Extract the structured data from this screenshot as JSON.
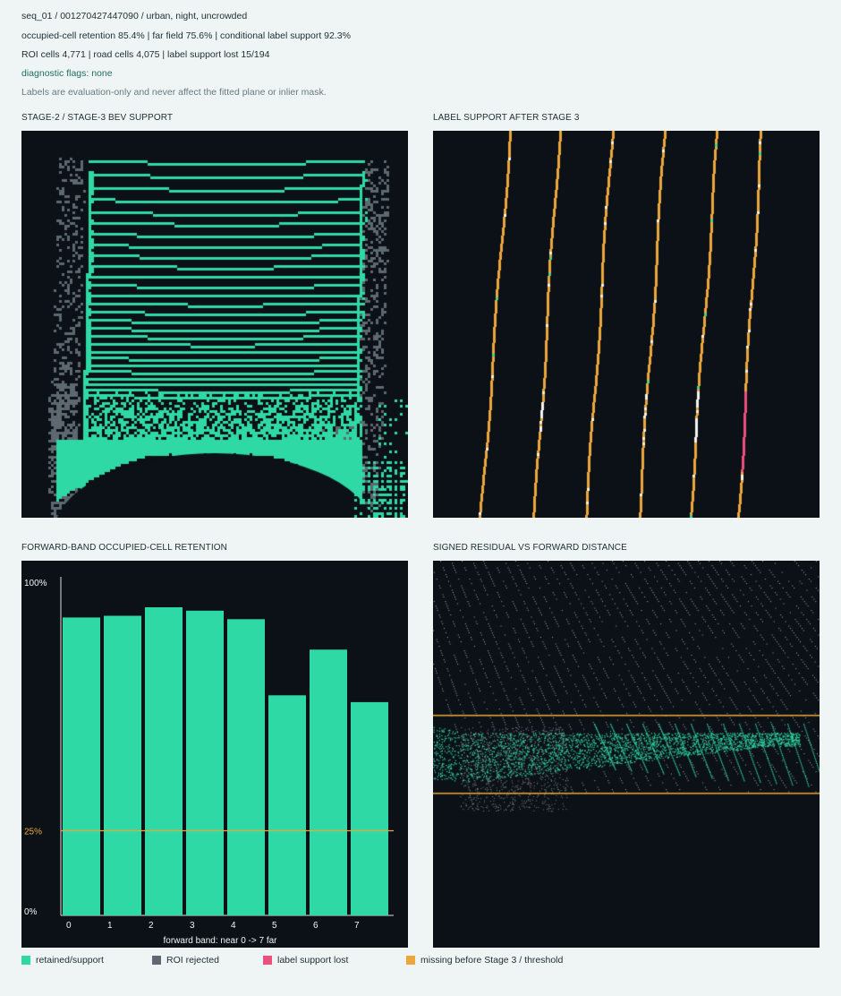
{
  "header": {
    "seq": "seq_01 / 001270427447090 / urban, night, uncrowded",
    "metrics": "occupied-cell retention 85.4% | far field 75.6% | conditional label support 92.3%",
    "counts": "ROI cells 4,771 | road cells 4,075 | label support lost 15/194",
    "flags": "diagnostic flags: none",
    "note": "Labels are evaluation-only and never affect the fitted plane or inlier mask."
  },
  "panels": {
    "bev_title": "STAGE-2 / STAGE-3 BEV SUPPORT",
    "label_title": "LABEL SUPPORT AFTER STAGE 3",
    "retention_title": "FORWARD-BAND OCCUPIED-CELL RETENTION",
    "residual_title": "SIGNED RESIDUAL VS FORWARD DISTANCE"
  },
  "colors": {
    "retained": "#2fd9a6",
    "rejected": "#5d6870",
    "lost": "#ee4f7e",
    "missing": "#eda63c",
    "panel_bg": "#0b1116"
  },
  "chart_data": [
    {
      "type": "bar",
      "xlabel": "forward band: near 0 -> 7 far",
      "categories": [
        "0",
        "1",
        "2",
        "3",
        "4",
        "5",
        "6",
        "7"
      ],
      "values": [
        88,
        88.5,
        91,
        90,
        87.5,
        65,
        78.5,
        63
      ],
      "ylim": [
        0,
        100
      ],
      "yticks": [
        "0%",
        "25%",
        "100%"
      ],
      "threshold": 25,
      "threshold_label": "25%",
      "legend": "bottom"
    }
  ],
  "legend": [
    {
      "label": "retained/support",
      "color": "#2fd9a6"
    },
    {
      "label": "ROI rejected",
      "color": "#5d6870"
    },
    {
      "label": "label support lost",
      "color": "#ee4f7e"
    },
    {
      "label": "missing before Stage 3 / threshold",
      "color": "#eda63c"
    }
  ]
}
